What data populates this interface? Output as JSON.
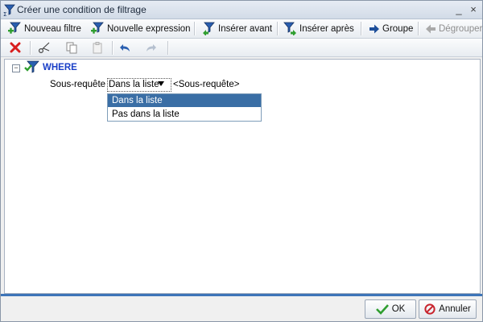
{
  "window": {
    "title": "Créer une condition de filtrage",
    "close_glyph": "×",
    "minimize_glyph": "_"
  },
  "toolbar_main": {
    "items": [
      {
        "label": "Nouveau filtre",
        "icon": "new-filter-icon"
      },
      {
        "label": "Nouvelle expression",
        "icon": "new-expression-icon"
      },
      {
        "label": "Insérer avant",
        "icon": "insert-before-icon"
      },
      {
        "label": "Insérer après",
        "icon": "insert-after-icon"
      },
      {
        "label": "Groupe",
        "icon": "group-arrow-icon"
      },
      {
        "label": "Dégrouper",
        "icon": "ungroup-arrow-icon",
        "disabled": true
      }
    ]
  },
  "toolbar_edit": {
    "icons": [
      "delete-icon",
      "cut-icon",
      "copy-icon",
      "paste-icon",
      "undo-icon",
      "redo-icon"
    ]
  },
  "tree": {
    "collapse_glyph": "−",
    "where_label": "WHERE",
    "condition": {
      "label": "Sous-requête",
      "selected": "Dans la liste",
      "placeholder": "<Sous-requête>",
      "options": [
        "Dans la liste",
        "Pas dans la liste"
      ],
      "highlighted_index": 0
    }
  },
  "footer": {
    "ok_label": "OK",
    "cancel_label": "Annuler"
  },
  "colors": {
    "accent": "#3d74b8",
    "where_text": "#1a3fc7",
    "selection": "#3a6ea5",
    "delete_red": "#d81e1e",
    "ok_green": "#2f9e2f",
    "cancel_red": "#c8232c"
  }
}
